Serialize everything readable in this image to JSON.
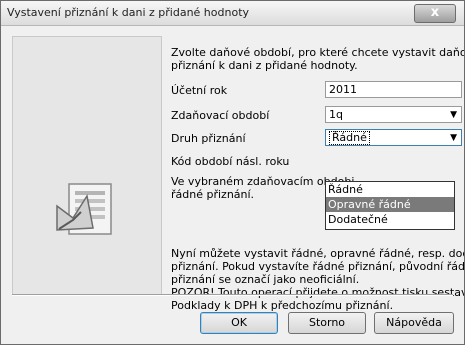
{
  "window": {
    "title": "Vystavení přiznání k dani z přidané hodnoty",
    "close_label": "x"
  },
  "intro": [
    "Zvolte daňové období, pro které chcete vystavit daňové",
    "přiznání k dani z přidané hodnoty."
  ],
  "fields": {
    "ucetni_rok": {
      "label": "Účetní rok",
      "value": "2011"
    },
    "zdanovaci_obdobi": {
      "label": "Zdaňovací období",
      "value": "1q"
    },
    "druh_priznani": {
      "label": "Druh přiznání",
      "value": "Řádné"
    },
    "kod_obdobi": {
      "label": "Kód období násl. roku"
    }
  },
  "dropdown": {
    "options": [
      "Řádné",
      "Opravné řádné",
      "Dodatečné"
    ],
    "highlighted": "Opravné řádné"
  },
  "note": [
    "Ve vybraném zdaňovacím obdobi",
    "řádné přiznání."
  ],
  "info": [
    "Nyní můžete vystavit řádné, opravné řádné, resp. dodatečné",
    "přiznání. Pokud vystavíte řádné přiznání, původní řádné",
    "přiznání se označí jako neoficiální.",
    "POZOR! Touto operací přijdete o možnost tisku sestavy",
    "Podklady k DPH k předchozímu přiznání."
  ],
  "buttons": {
    "ok": "OK",
    "storno": "Storno",
    "napoveda": "Nápověda"
  }
}
